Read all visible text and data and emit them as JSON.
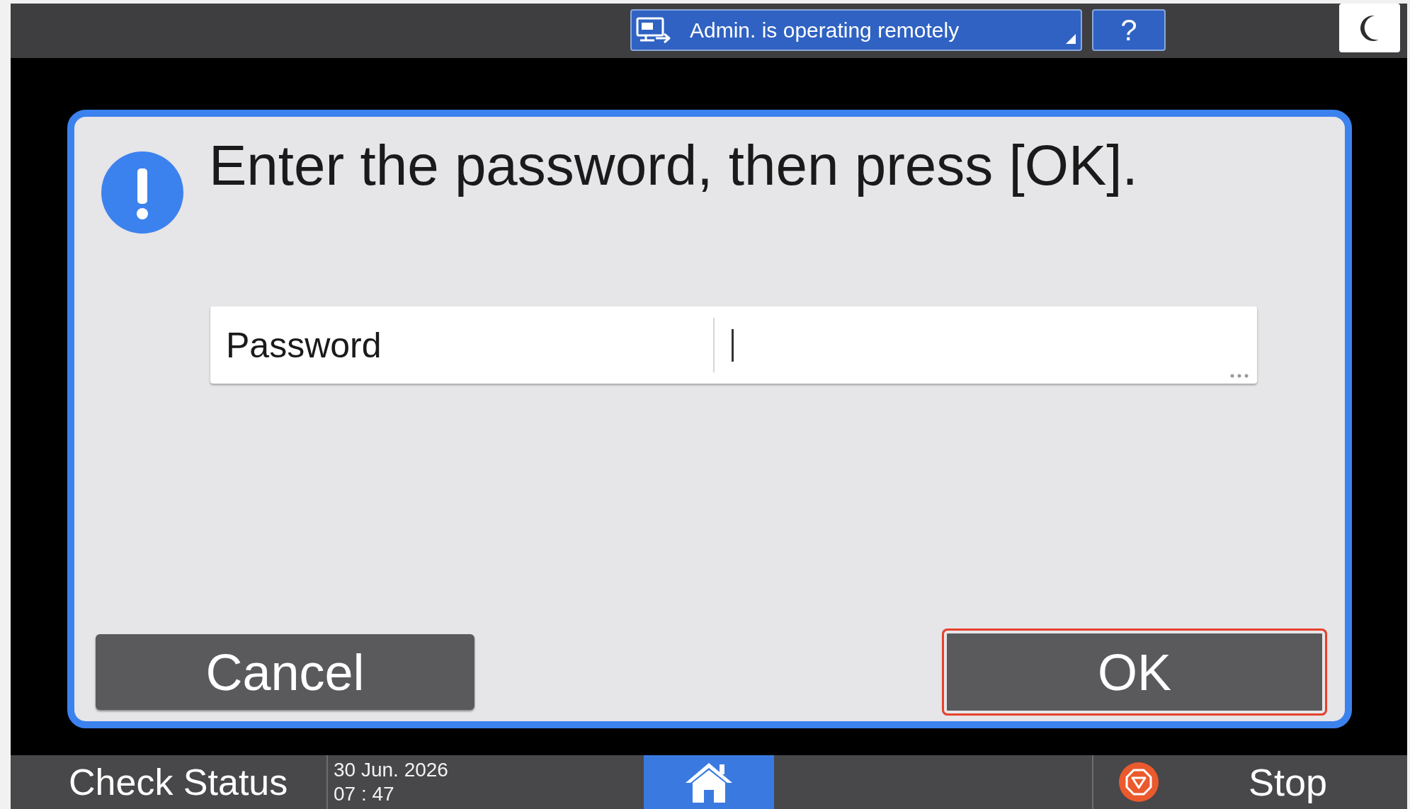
{
  "top_bar": {
    "remote_status": {
      "label": "Admin. is operating remotely"
    },
    "help_button": {
      "label": "?"
    }
  },
  "dialog": {
    "message": "Enter the password, then press [OK].",
    "password": {
      "label": "Password",
      "focused": true
    },
    "buttons": [
      {
        "label": "Cancel",
        "selected": false
      },
      {
        "label": "OK",
        "selected": true
      }
    ]
  },
  "status_bar": {
    "check_status": {
      "label": "Check Status"
    },
    "date": "30 Jun. 2026",
    "time": "07 : 47",
    "stop": {
      "label": "Stop"
    }
  }
}
